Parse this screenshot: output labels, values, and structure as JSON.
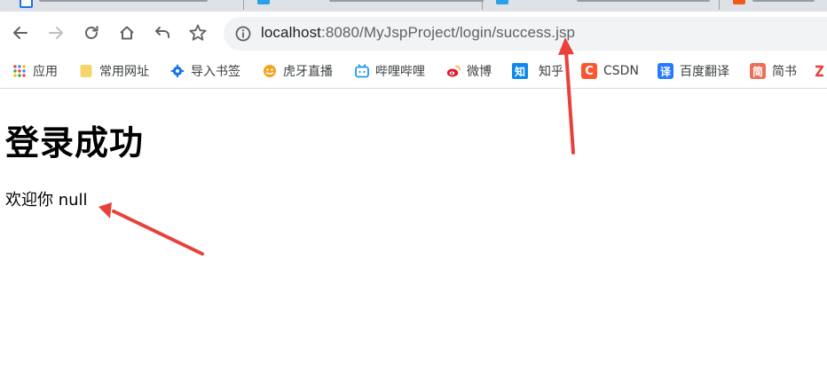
{
  "browser": {
    "omnibox": {
      "host": "localhost",
      "rest": ":8080/MyJspProject/login/success.jsp"
    },
    "bookmarks": [
      {
        "label": "应用",
        "icon": "apps-grid-icon"
      },
      {
        "label": "常用网址",
        "icon": "folder-icon"
      },
      {
        "label": "导入书签",
        "icon": "gear-icon"
      },
      {
        "label": "虎牙直播",
        "icon": "huya-icon"
      },
      {
        "label": "哔哩哔哩",
        "icon": "bilibili-icon"
      },
      {
        "label": "微博",
        "icon": "weibo-icon"
      },
      {
        "label": "知乎",
        "icon": "zhihu-icon"
      },
      {
        "label": "CSDN",
        "icon": "csdn-icon"
      },
      {
        "label": "百度翻译",
        "icon": "baidu-translate-icon"
      },
      {
        "label": "简书",
        "icon": "jianshu-icon"
      }
    ],
    "colors": {
      "toolbar_bg": "#ffffff",
      "omnibox_bg": "#f1f3f4",
      "tab_bg": "#dee1e6",
      "arrow": "#e8413c"
    }
  },
  "page": {
    "title": "登录成功",
    "welcome": "欢迎你 null"
  }
}
